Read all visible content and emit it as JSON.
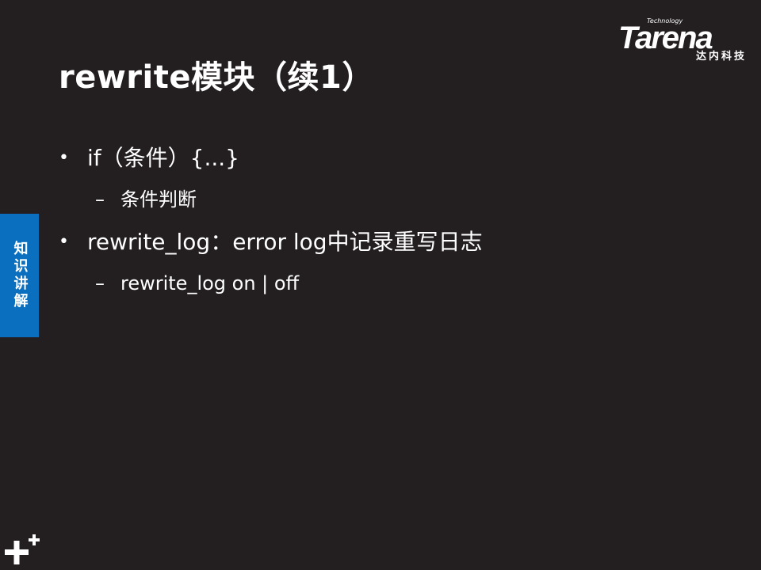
{
  "slide": {
    "title": "rewrite模块（续1）",
    "bullets": [
      {
        "text": "if（条件）{...}",
        "sub": [
          "条件判断"
        ]
      },
      {
        "text": "rewrite_log：error log中记录重写日志",
        "sub": [
          "rewrite_log on | off"
        ]
      }
    ]
  },
  "logo": {
    "main": "Tarena",
    "tagline": "Technology",
    "sub": "达内科技"
  },
  "side_tab": {
    "label": "知识讲解",
    "color": "#0b6fbf"
  },
  "icons": {
    "bullet": "•",
    "dash": "–",
    "footer": "plus-icon"
  },
  "colors": {
    "background": "#231f20",
    "text": "#ffffff"
  }
}
